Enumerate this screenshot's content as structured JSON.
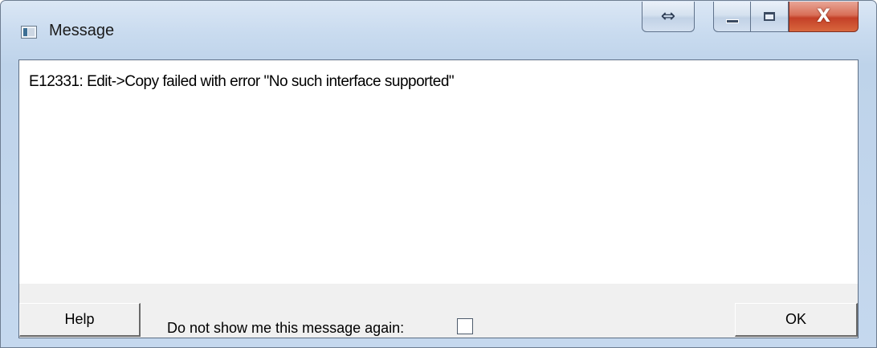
{
  "window": {
    "title": "Message",
    "icon": "message-window-icon",
    "buttons": {
      "resize_glyph": "⇔",
      "resize_icon": "horizontal-resize-icon",
      "minimize_icon": "minimize-icon",
      "maximize_icon": "maximize-icon",
      "close_glyph": "X",
      "close_icon": "close-icon"
    }
  },
  "message": {
    "text": "E12331: Edit->Copy failed with error \"No such interface supported\""
  },
  "footer": {
    "help_label": "Help",
    "checkbox_label": "Do not show me this message again:",
    "checkbox_checked": false,
    "ok_label": "OK"
  },
  "colors": {
    "close_button": "#c44027",
    "title_bar": "#c9dbef",
    "panel": "#f0f0f0"
  }
}
